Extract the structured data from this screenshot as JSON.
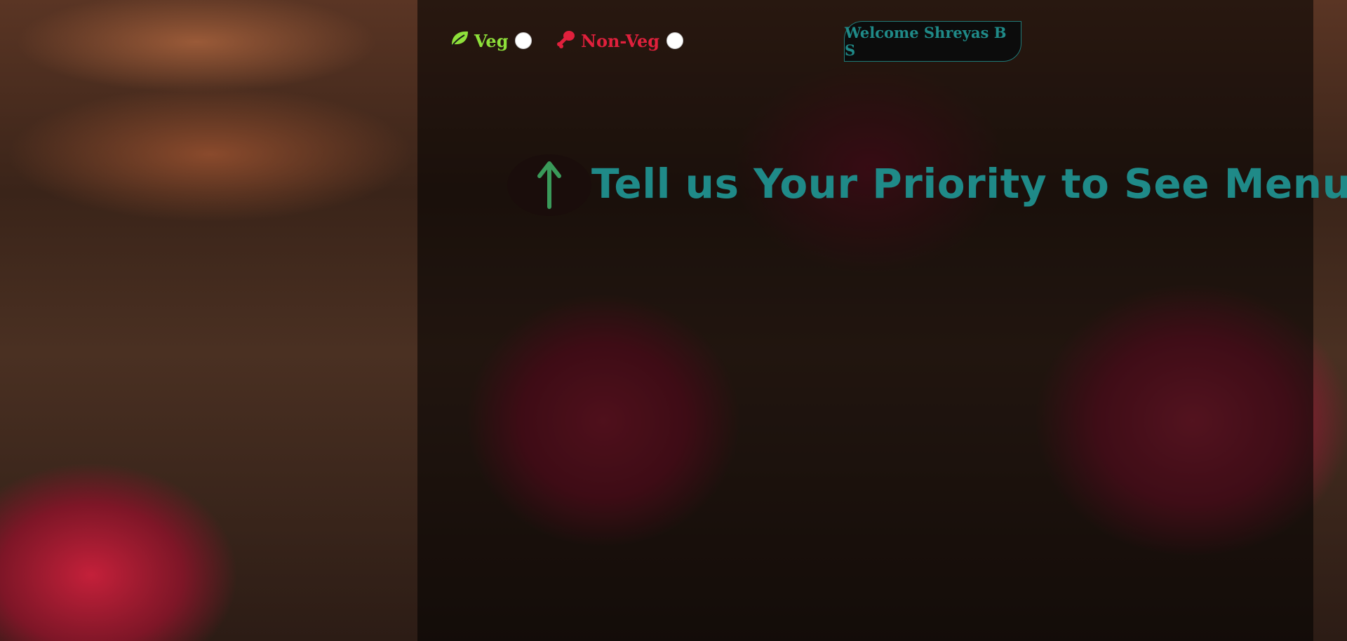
{
  "diet_options": {
    "veg": {
      "label": "Veg",
      "icon": "leaf-icon",
      "color": "#8ee03a"
    },
    "nonveg": {
      "label": "Non-Veg",
      "icon": "drumstick-icon",
      "color": "#e0203c"
    }
  },
  "header": {
    "welcome_text": "Welcome Shreyas B S"
  },
  "prompt": {
    "arrow_icon": "arrow-up-icon",
    "heading": "Tell us Your Priority to See Menu"
  },
  "colors": {
    "accent": "#1f8a88",
    "overlay": "rgba(0,0,0,0.55)"
  }
}
